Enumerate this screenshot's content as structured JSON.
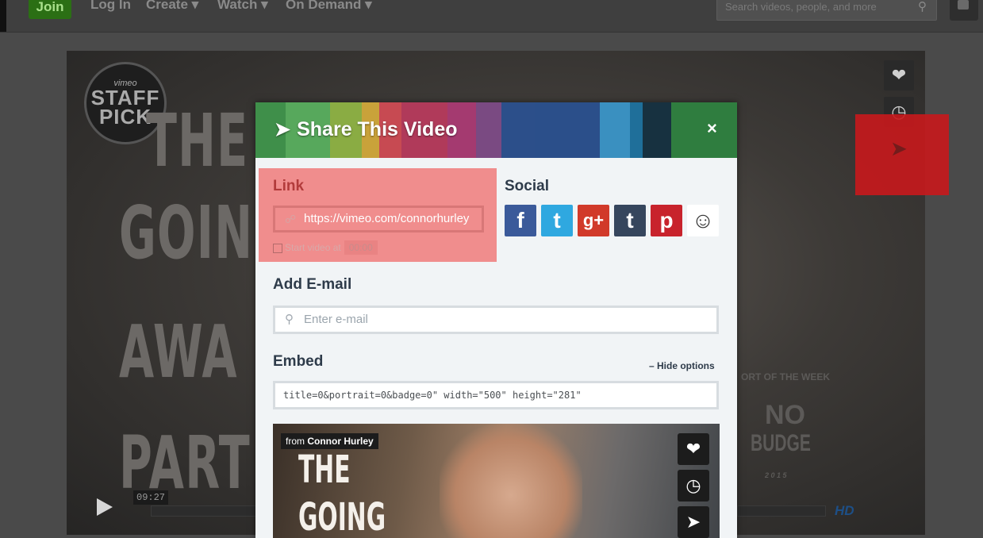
{
  "nav": {
    "join": "Join",
    "login": "Log In",
    "create": "Create ▾",
    "watch": "Watch ▾",
    "on_demand": "On Demand ▾",
    "search_placeholder": "Search videos, people, and more",
    "search_icon": "⚲"
  },
  "player": {
    "title_words": [
      "THE",
      "GOIN",
      "AWA",
      "PART"
    ],
    "badge_top": "vimeo",
    "badge_mid": "STAFF",
    "badge_bottom": "PICK",
    "time": "09:27",
    "right_caption": "ORT OF THE WEEK",
    "right_logo_1": "NO",
    "right_logo_2": "BUDGE",
    "right_logo_year": "2 0 1 5",
    "hd": "HD",
    "like_icon": "❤",
    "later_icon": "◷",
    "share_icon": "➤"
  },
  "modal": {
    "title": "Share This Video",
    "plane_icon": "➤",
    "close": "×",
    "header_stripes": [
      "#3f8f4a",
      "#57a85c",
      "#8aac43",
      "#c9a23a",
      "#c74a52",
      "#b03a5a",
      "#a43a70",
      "#7a4a82",
      "#2c4f8a",
      "#2b4f8a",
      "#3a90c0",
      "#1f6f9a",
      "#173140",
      "#2f7d3f"
    ],
    "link": {
      "label": "Link",
      "url": "https://vimeo.com/connorhurley",
      "start_label": "Start video at",
      "start_time": "00:00"
    },
    "social": {
      "label": "Social",
      "icons": [
        {
          "name": "facebook",
          "glyph": "f",
          "color": "#3b5a9a"
        },
        {
          "name": "twitter",
          "glyph": "t",
          "color": "#2fa8e0"
        },
        {
          "name": "googleplus",
          "glyph": "g+",
          "color": "#d13a2a"
        },
        {
          "name": "tumblr",
          "glyph": "t",
          "color": "#36465d"
        },
        {
          "name": "pinterest",
          "glyph": "p",
          "color": "#c8232c"
        },
        {
          "name": "reddit",
          "glyph": "☺",
          "color": "#ffffff"
        }
      ]
    },
    "email": {
      "label": "Add E-mail",
      "placeholder": "Enter e-mail"
    },
    "embed": {
      "label": "Embed",
      "hide_options": "– Hide options",
      "code": "title=0&portrait=0&badge=0\" width=\"500\" height=\"281\""
    },
    "preview": {
      "from_prefix": "from ",
      "from_author": "Connor Hurley",
      "title_words": [
        "THE",
        "GOING"
      ]
    }
  }
}
